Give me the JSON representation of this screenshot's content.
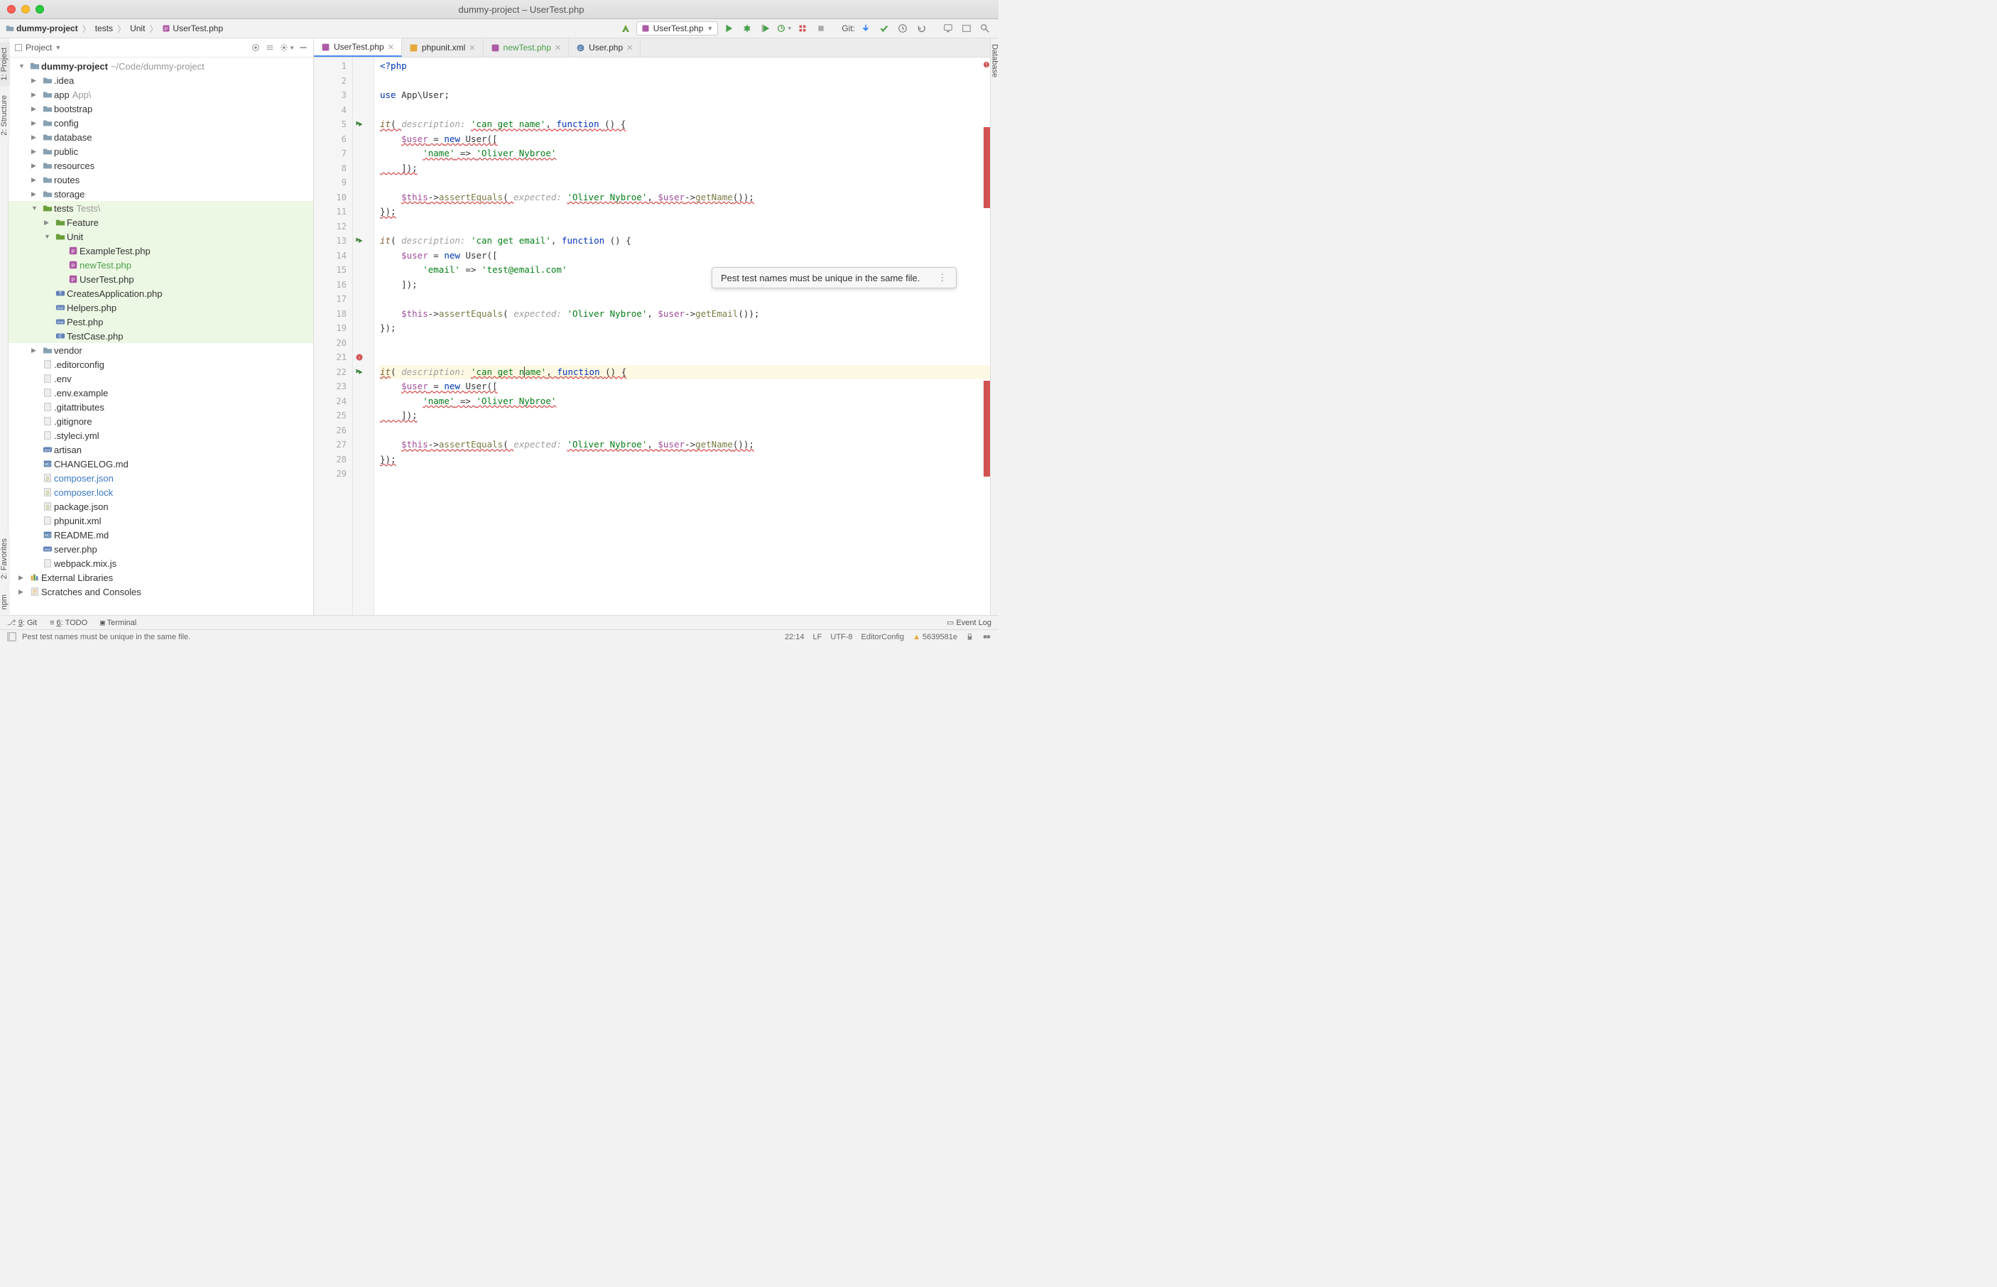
{
  "window": {
    "title": "dummy-project – UserTest.php"
  },
  "breadcrumb": {
    "project": "dummy-project",
    "parts": [
      "tests",
      "Unit"
    ],
    "file": "UserTest.php"
  },
  "toolbar": {
    "run_config": "UserTest.php",
    "git_label": "Git:"
  },
  "side_tabs": {
    "left": [
      "1: Project",
      "2: Structure",
      "2: Favorites",
      "npm"
    ],
    "right": [
      "Database"
    ]
  },
  "project_panel": {
    "title": "Project",
    "tree": {
      "root": {
        "name": "dummy-project",
        "path": "~/Code/dummy-project"
      },
      "items": [
        {
          "depth": 1,
          "type": "folder",
          "name": ".idea",
          "expandable": true
        },
        {
          "depth": 1,
          "type": "folder",
          "name": "app",
          "suffix": "App\\",
          "expandable": true
        },
        {
          "depth": 1,
          "type": "folder",
          "name": "bootstrap",
          "expandable": true
        },
        {
          "depth": 1,
          "type": "folder",
          "name": "config",
          "expandable": true
        },
        {
          "depth": 1,
          "type": "folder",
          "name": "database",
          "expandable": true
        },
        {
          "depth": 1,
          "type": "folder",
          "name": "public",
          "expandable": true
        },
        {
          "depth": 1,
          "type": "folder",
          "name": "resources",
          "expandable": true
        },
        {
          "depth": 1,
          "type": "folder",
          "name": "routes",
          "expandable": true
        },
        {
          "depth": 1,
          "type": "folder",
          "name": "storage",
          "expandable": true
        },
        {
          "depth": 1,
          "type": "folder-test",
          "name": "tests",
          "suffix": "Tests\\",
          "expandable": true,
          "expanded": true,
          "hl": true
        },
        {
          "depth": 2,
          "type": "folder-test",
          "name": "Feature",
          "expandable": true,
          "hl": true
        },
        {
          "depth": 2,
          "type": "folder-test",
          "name": "Unit",
          "expandable": true,
          "expanded": true,
          "hl": true
        },
        {
          "depth": 3,
          "type": "file-php-test",
          "name": "ExampleTest.php",
          "hl": true
        },
        {
          "depth": 3,
          "type": "file-php-test",
          "name": "newTest.php",
          "hl": true,
          "green": true
        },
        {
          "depth": 3,
          "type": "file-php-test",
          "name": "UserTest.php",
          "hl": true
        },
        {
          "depth": 2,
          "type": "file-php",
          "name": "CreatesApplication.php",
          "hl": true,
          "icon": "T"
        },
        {
          "depth": 2,
          "type": "file-php",
          "name": "Helpers.php",
          "hl": true,
          "icon": "PHP"
        },
        {
          "depth": 2,
          "type": "file-php",
          "name": "Pest.php",
          "hl": true,
          "icon": "PHP"
        },
        {
          "depth": 2,
          "type": "file-php",
          "name": "TestCase.php",
          "hl": true,
          "icon": "C"
        },
        {
          "depth": 1,
          "type": "folder",
          "name": "vendor",
          "expandable": true
        },
        {
          "depth": 1,
          "type": "file",
          "name": ".editorconfig"
        },
        {
          "depth": 1,
          "type": "file",
          "name": ".env"
        },
        {
          "depth": 1,
          "type": "file",
          "name": ".env.example"
        },
        {
          "depth": 1,
          "type": "file",
          "name": ".gitattributes"
        },
        {
          "depth": 1,
          "type": "file",
          "name": ".gitignore"
        },
        {
          "depth": 1,
          "type": "file",
          "name": ".styleci.yml"
        },
        {
          "depth": 1,
          "type": "file-php",
          "name": "artisan",
          "icon": "PHP"
        },
        {
          "depth": 1,
          "type": "file-md",
          "name": "CHANGELOG.md"
        },
        {
          "depth": 1,
          "type": "file-json",
          "name": "composer.json",
          "blue": true
        },
        {
          "depth": 1,
          "type": "file-json",
          "name": "composer.lock",
          "blue": true
        },
        {
          "depth": 1,
          "type": "file-json",
          "name": "package.json"
        },
        {
          "depth": 1,
          "type": "file",
          "name": "phpunit.xml"
        },
        {
          "depth": 1,
          "type": "file-md",
          "name": "README.md"
        },
        {
          "depth": 1,
          "type": "file-php",
          "name": "server.php",
          "icon": "PHP"
        },
        {
          "depth": 1,
          "type": "file",
          "name": "webpack.mix.js"
        }
      ],
      "extras": [
        {
          "name": "External Libraries",
          "icon": "lib"
        },
        {
          "name": "Scratches and Consoles",
          "icon": "scratch"
        }
      ]
    }
  },
  "tabs": [
    {
      "name": "UserTest.php",
      "active": true,
      "icon": "pest",
      "color": "blue"
    },
    {
      "name": "phpunit.xml",
      "icon": "xml"
    },
    {
      "name": "newTest.php",
      "icon": "pest",
      "color": "green"
    },
    {
      "name": "User.php",
      "icon": "class"
    }
  ],
  "editor": {
    "lines": 29,
    "gutter_marks": {
      "5": "play2",
      "13": "play2",
      "21": "error",
      "22": "play2"
    },
    "code": [
      {
        "n": 1,
        "tokens": [
          {
            "t": "<?php",
            "c": "kw"
          }
        ]
      },
      {
        "n": 2,
        "tokens": []
      },
      {
        "n": 3,
        "tokens": [
          {
            "t": "use ",
            "c": "kw"
          },
          {
            "t": "App\\User",
            "c": ""
          },
          {
            "t": ";",
            "c": ""
          }
        ]
      },
      {
        "n": 4,
        "tokens": []
      },
      {
        "n": 5,
        "tokens": [
          {
            "t": "it",
            "c": "fn wavy"
          },
          {
            "t": "( ",
            "c": "wavy"
          },
          {
            "t": "description: ",
            "c": "hint"
          },
          {
            "t": "'can get name'",
            "c": "str wavy"
          },
          {
            "t": ", ",
            "c": "wavy"
          },
          {
            "t": "function ",
            "c": "kw wavy"
          },
          {
            "t": "() {",
            "c": "wavy"
          }
        ]
      },
      {
        "n": 6,
        "tokens": [
          {
            "t": "    ",
            "c": ""
          },
          {
            "t": "$user",
            "c": "var wavy"
          },
          {
            "t": " = ",
            "c": "wavy"
          },
          {
            "t": "new ",
            "c": "kw wavy"
          },
          {
            "t": "User([",
            "c": "wavy"
          }
        ]
      },
      {
        "n": 7,
        "tokens": [
          {
            "t": "        ",
            "c": ""
          },
          {
            "t": "'name'",
            "c": "str wavy"
          },
          {
            "t": " => ",
            "c": "wavy"
          },
          {
            "t": "'Oliver Nybroe'",
            "c": "str wavy"
          }
        ]
      },
      {
        "n": 8,
        "tokens": [
          {
            "t": "    ]);",
            "c": "wavy"
          }
        ]
      },
      {
        "n": 9,
        "tokens": []
      },
      {
        "n": 10,
        "tokens": [
          {
            "t": "    ",
            "c": ""
          },
          {
            "t": "$this",
            "c": "var wavy"
          },
          {
            "t": "->",
            "c": "wavy"
          },
          {
            "t": "assertEquals",
            "c": "mtd wavy"
          },
          {
            "t": "( ",
            "c": "wavy"
          },
          {
            "t": "expected: ",
            "c": "hint"
          },
          {
            "t": "'Oliver Nybroe'",
            "c": "str wavy"
          },
          {
            "t": ", ",
            "c": "wavy"
          },
          {
            "t": "$user",
            "c": "var wavy"
          },
          {
            "t": "->",
            "c": "wavy"
          },
          {
            "t": "getName",
            "c": "mtd wavy"
          },
          {
            "t": "());",
            "c": "wavy"
          }
        ]
      },
      {
        "n": 11,
        "tokens": [
          {
            "t": "});",
            "c": "wavy"
          }
        ]
      },
      {
        "n": 12,
        "tokens": []
      },
      {
        "n": 13,
        "tokens": [
          {
            "t": "it",
            "c": "fn"
          },
          {
            "t": "( ",
            "c": ""
          },
          {
            "t": "description: ",
            "c": "hint"
          },
          {
            "t": "'can get email'",
            "c": "str"
          },
          {
            "t": ", ",
            "c": ""
          },
          {
            "t": "function ",
            "c": "kw"
          },
          {
            "t": "() {",
            "c": ""
          }
        ]
      },
      {
        "n": 14,
        "tokens": [
          {
            "t": "    ",
            "c": ""
          },
          {
            "t": "$user",
            "c": "var"
          },
          {
            "t": " = ",
            "c": ""
          },
          {
            "t": "new ",
            "c": "kw"
          },
          {
            "t": "User([",
            "c": ""
          }
        ]
      },
      {
        "n": 15,
        "tokens": [
          {
            "t": "        ",
            "c": ""
          },
          {
            "t": "'email'",
            "c": "str"
          },
          {
            "t": " => ",
            "c": ""
          },
          {
            "t": "'test@email.com'",
            "c": "str"
          }
        ]
      },
      {
        "n": 16,
        "tokens": [
          {
            "t": "    ]);",
            "c": ""
          }
        ]
      },
      {
        "n": 17,
        "tokens": []
      },
      {
        "n": 18,
        "tokens": [
          {
            "t": "    ",
            "c": ""
          },
          {
            "t": "$this",
            "c": "var"
          },
          {
            "t": "->",
            "c": ""
          },
          {
            "t": "assertEquals",
            "c": "mtd"
          },
          {
            "t": "( ",
            "c": ""
          },
          {
            "t": "expected: ",
            "c": "hint"
          },
          {
            "t": "'Oliver Nybroe'",
            "c": "str"
          },
          {
            "t": ", ",
            "c": ""
          },
          {
            "t": "$user",
            "c": "var"
          },
          {
            "t": "->",
            "c": ""
          },
          {
            "t": "getEmail",
            "c": "mtd"
          },
          {
            "t": "());",
            "c": ""
          }
        ]
      },
      {
        "n": 19,
        "tokens": [
          {
            "t": "});",
            "c": ""
          }
        ]
      },
      {
        "n": 20,
        "tokens": []
      },
      {
        "n": 21,
        "tokens": []
      },
      {
        "n": 22,
        "hl": true,
        "tokens": [
          {
            "t": "it",
            "c": "fn wavy"
          },
          {
            "t": "( ",
            "c": ""
          },
          {
            "t": "description: ",
            "c": "hint"
          },
          {
            "t": "'can get n",
            "c": "str wavy"
          },
          {
            "t": "",
            "c": "caret"
          },
          {
            "t": "ame'",
            "c": "str wavy"
          },
          {
            "t": ", ",
            "c": "wavy"
          },
          {
            "t": "function ",
            "c": "kw wavy"
          },
          {
            "t": "() {",
            "c": "wavy"
          }
        ]
      },
      {
        "n": 23,
        "tokens": [
          {
            "t": "    ",
            "c": ""
          },
          {
            "t": "$user",
            "c": "var wavy"
          },
          {
            "t": " = ",
            "c": "wavy"
          },
          {
            "t": "new ",
            "c": "kw wavy"
          },
          {
            "t": "User([",
            "c": "wavy"
          }
        ]
      },
      {
        "n": 24,
        "tokens": [
          {
            "t": "        ",
            "c": ""
          },
          {
            "t": "'name'",
            "c": "str wavy"
          },
          {
            "t": " => ",
            "c": "wavy"
          },
          {
            "t": "'Oliver Nybroe'",
            "c": "str wavy"
          }
        ]
      },
      {
        "n": 25,
        "tokens": [
          {
            "t": "    ]);",
            "c": "wavy"
          }
        ]
      },
      {
        "n": 26,
        "tokens": []
      },
      {
        "n": 27,
        "tokens": [
          {
            "t": "    ",
            "c": ""
          },
          {
            "t": "$this",
            "c": "var wavy"
          },
          {
            "t": "->",
            "c": "wavy"
          },
          {
            "t": "assertEquals",
            "c": "mtd wavy"
          },
          {
            "t": "( ",
            "c": "wavy"
          },
          {
            "t": "expected: ",
            "c": "hint"
          },
          {
            "t": "'Oliver Nybroe'",
            "c": "str wavy"
          },
          {
            "t": ", ",
            "c": "wavy"
          },
          {
            "t": "$user",
            "c": "var wavy"
          },
          {
            "t": "->",
            "c": "wavy"
          },
          {
            "t": "getName",
            "c": "mtd wavy"
          },
          {
            "t": "());",
            "c": "wavy"
          }
        ]
      },
      {
        "n": 28,
        "tokens": [
          {
            "t": "});",
            "c": "wavy"
          }
        ]
      },
      {
        "n": 29,
        "tokens": []
      }
    ],
    "tooltip": "Pest test names must be unique in the same file."
  },
  "bottom_bar": {
    "git": "9: Git",
    "todo": "6: TODO",
    "terminal": "Terminal",
    "event_log": "Event Log"
  },
  "status_bar": {
    "message": "Pest test names must be unique in the same file.",
    "cursor": "22:14",
    "line_sep": "LF",
    "encoding": "UTF-8",
    "editorconfig": "EditorConfig",
    "commit": "5639581e"
  }
}
